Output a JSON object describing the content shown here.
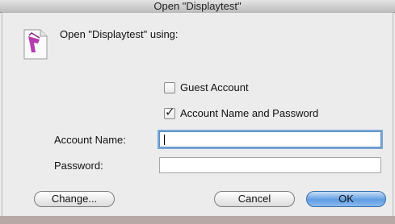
{
  "window": {
    "title": "Open \"Displaytest\""
  },
  "dialog": {
    "prompt": "Open \"Displaytest\" using:",
    "options": [
      {
        "label": "Guest Account",
        "checked": false
      },
      {
        "label": "Account Name and Password",
        "checked": true
      }
    ],
    "account_name_label": "Account Name:",
    "account_name_value": "",
    "password_label": "Password:",
    "password_value": "",
    "buttons": {
      "change": "Change...",
      "cancel": "Cancel",
      "ok": "OK"
    }
  },
  "colors": {
    "default_button": "#5f9de3",
    "focus_ring": "#7aa7d8",
    "app_icon": "#b53bb0"
  },
  "icons": {
    "app_icon": "remote-app-icon"
  }
}
